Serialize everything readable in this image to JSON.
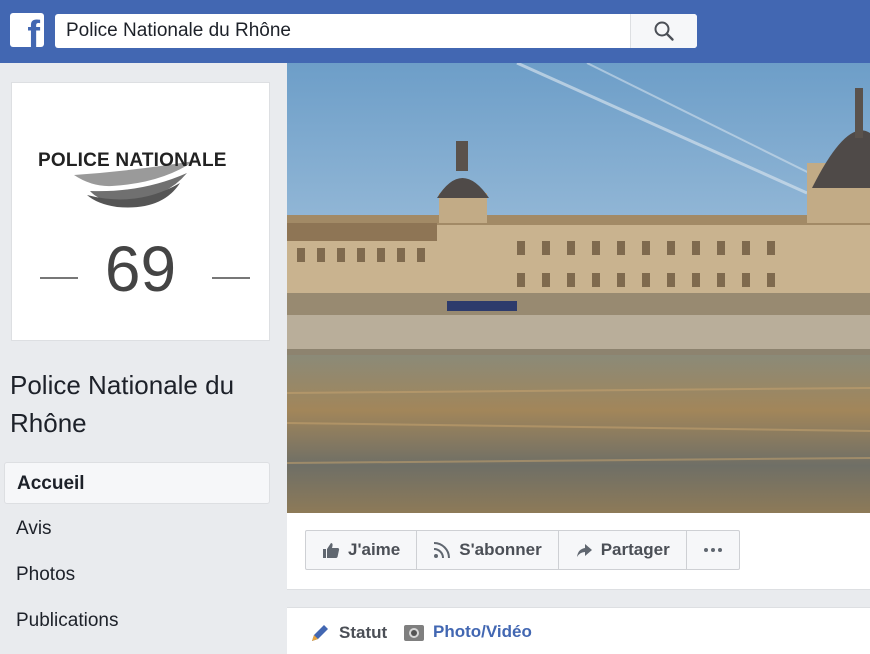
{
  "header": {
    "logo_letter": "f",
    "search_value": "Police Nationale du Rhône",
    "search_icon": "search-icon",
    "brand_color": "#4267b2"
  },
  "profile": {
    "logo_text": "POLICE NATIONALE",
    "number": "69"
  },
  "page_name": "Police Nationale du Rhône",
  "nav": {
    "items": [
      {
        "label": "Accueil",
        "active": true
      },
      {
        "label": "Avis"
      },
      {
        "label": "Photos"
      },
      {
        "label": "Publications"
      }
    ]
  },
  "actions": {
    "like": {
      "label": "J'aime",
      "icon": "thumbs-up-icon"
    },
    "follow": {
      "label": "S'abonner",
      "icon": "rss-icon"
    },
    "share": {
      "label": "Partager",
      "icon": "share-arrow-icon"
    },
    "more_icon": "more-dots-icon"
  },
  "composer": {
    "status": {
      "label": "Statut",
      "icon": "pencil-icon"
    },
    "photo": {
      "label": "Photo/Vidéo",
      "icon": "camera-icon"
    }
  }
}
